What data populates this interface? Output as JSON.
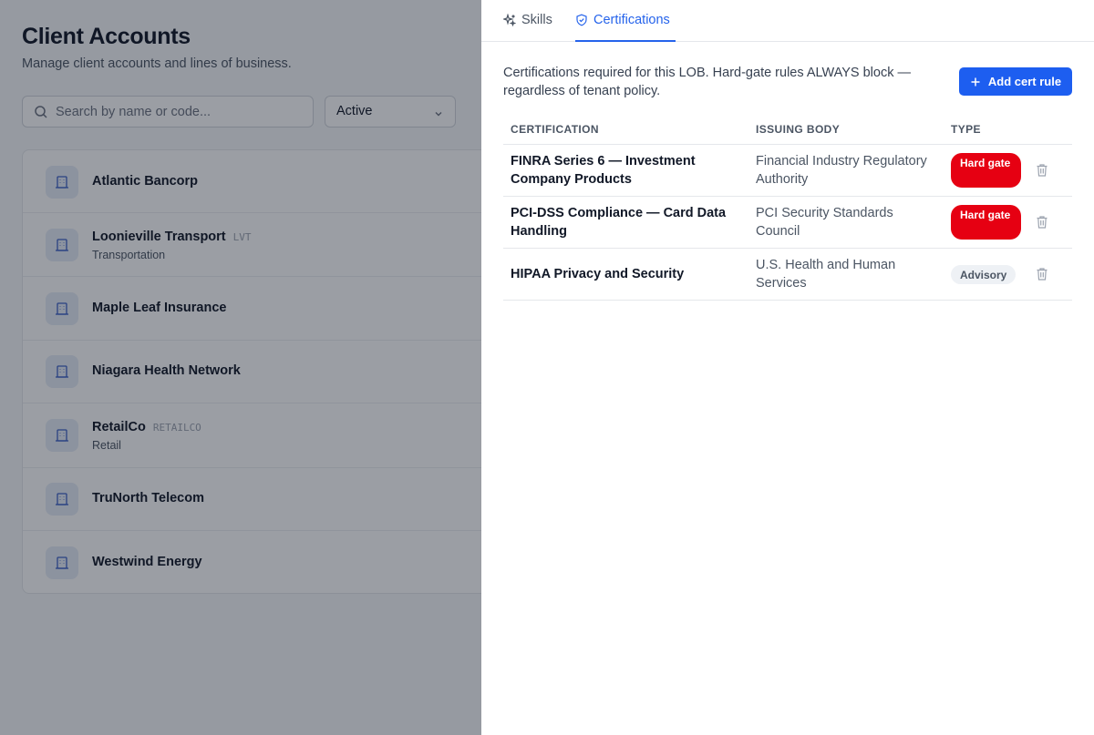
{
  "page": {
    "title": "Client Accounts",
    "subtitle": "Manage client accounts and lines of business.",
    "search_placeholder": "Search by name or code...",
    "status_filter": "Active"
  },
  "accounts": [
    {
      "name": "Atlantic Bancorp",
      "code": "",
      "sub": ""
    },
    {
      "name": "Loonieville Transport",
      "code": "LVT",
      "sub": "Transportation"
    },
    {
      "name": "Maple Leaf Insurance",
      "code": "",
      "sub": ""
    },
    {
      "name": "Niagara Health Network",
      "code": "",
      "sub": ""
    },
    {
      "name": "RetailCo",
      "code": "RETAILCO",
      "sub": "Retail"
    },
    {
      "name": "TruNorth Telecom",
      "code": "",
      "sub": ""
    },
    {
      "name": "Westwind Energy",
      "code": "",
      "sub": ""
    }
  ],
  "drawer": {
    "tabs": [
      {
        "label": "Skills",
        "icon": "sparkle-icon"
      },
      {
        "label": "Certifications",
        "icon": "shield-check-icon"
      }
    ],
    "active_tab": "Certifications",
    "intro": "Certifications required for this LOB. Hard-gate rules ALWAYS block — regardless of tenant policy.",
    "add_button": "Add cert rule",
    "columns": {
      "cert": "Certification",
      "body": "Issuing Body",
      "type": "Type"
    },
    "rows": [
      {
        "cert": "FINRA Series 6 — Investment Company Products",
        "body": "Financial Industry Regulatory Authority",
        "type": "Hard gate",
        "kind": "hard"
      },
      {
        "cert": "PCI-DSS Compliance — Card Data Handling",
        "body": "PCI Security Standards Council",
        "type": "Hard gate",
        "kind": "hard"
      },
      {
        "cert": "HIPAA Privacy and Security",
        "body": "U.S. Health and Human Services",
        "type": "Advisory",
        "kind": "advisory"
      }
    ]
  },
  "colors": {
    "accent": "#2563eb",
    "button": "#1d5ef0",
    "hard_gate": "#e60012",
    "advisory_bg": "#eef1f5",
    "overlay": "rgba(17,24,39,0.42)"
  }
}
